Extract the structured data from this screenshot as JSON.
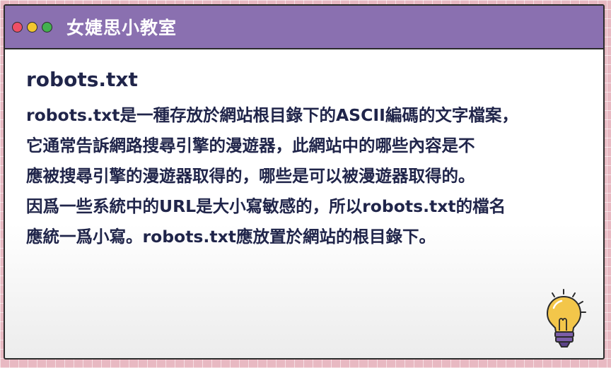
{
  "window": {
    "title": "女婕思小教室",
    "controls": [
      "close",
      "minimize",
      "maximize"
    ]
  },
  "content": {
    "heading": "robots.txt",
    "lines": [
      "robots.txt是一種存放於網站根目錄下的ASCII編碼的文字檔案，",
      "它通常告訴網路搜尋引擎的漫遊器，此網站中的哪些內容是不",
      "應被搜尋引擎的漫遊器取得的，哪些是可以被漫遊器取得的。",
      "因爲一些系統中的URL是大小寫敏感的，所以robots.txt的檔名",
      "應統一爲小寫。robots.txt應放置於網站的根目錄下。"
    ]
  },
  "decoration": {
    "icon": "lightbulb-icon"
  },
  "colors": {
    "titlebar": "#8a70b0",
    "text": "#20254a",
    "background": "#e8b9c2",
    "bulb": "#f3c64a",
    "bulb_base": "#7b5ea8"
  }
}
